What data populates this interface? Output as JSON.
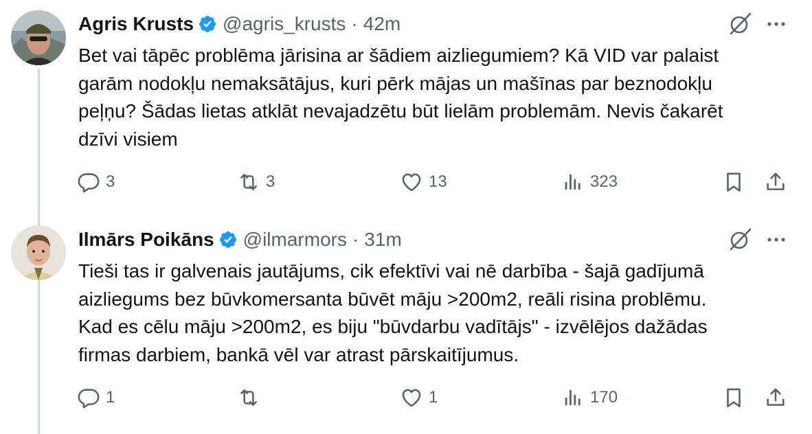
{
  "tweets": [
    {
      "name": "Agris Krusts",
      "handle": "@agris_krusts",
      "separator": "·",
      "time": "42m",
      "text_lines": [
        "Bet vai tāpēc problēma jārisina ar šādiem aizliegumiem? Kā VID var palaist",
        "garām nodokļu nemaksātājus, kuri pērk mājas un mašīnas par beznodokļu",
        "peļņu? Šādas lietas atklāt nevajadzētu būt lielām problemām. Nevis čakarēt",
        "dzīvi visiem"
      ],
      "replies": "3",
      "reposts": "3",
      "likes": "13",
      "views": "323"
    },
    {
      "name": "Ilmārs Poikāns",
      "handle": "@ilmarmors",
      "separator": "·",
      "time": "31m",
      "text_lines": [
        "Tieši tas ir galvenais jautājums, cik efektīvi vai nē darbība - šajā gadījumā",
        "aizliegums bez būvkomersanta būvēt māju >200m2, reāli risina problēmu.",
        "Kad es cēlu māju >200m2, es biju \"būvdarbu vadītājs\" - izvēlējos dažādas",
        "firmas darbiem, bankā vēl var atrast pārskaitījumus."
      ],
      "replies": "1",
      "reposts": "",
      "likes": "1",
      "views": "170"
    }
  ],
  "colors": {
    "verified": "#1d9bf0",
    "text": "#0f1419",
    "secondary": "#536471",
    "thread_line": "#cfd9de"
  },
  "icons": [
    "verified-badge-icon",
    "grok-icon",
    "more-icon",
    "reply-icon",
    "repost-icon",
    "like-icon",
    "views-icon",
    "bookmark-icon",
    "share-icon"
  ]
}
